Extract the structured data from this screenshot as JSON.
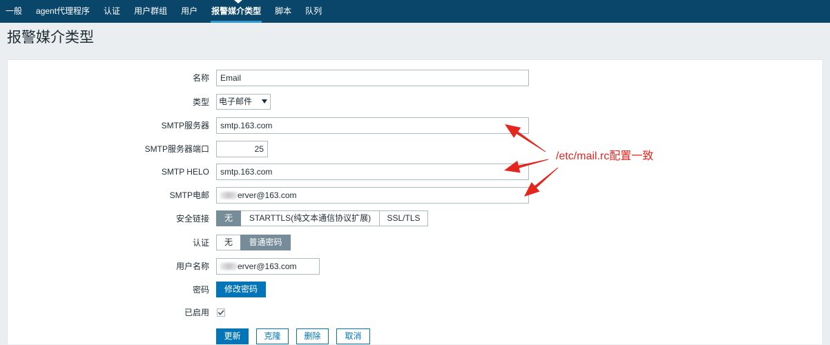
{
  "nav": {
    "items": [
      {
        "label": "一般",
        "active": false
      },
      {
        "label": "agent代理程序",
        "active": false
      },
      {
        "label": "认证",
        "active": false
      },
      {
        "label": "用户群组",
        "active": false
      },
      {
        "label": "用户",
        "active": false
      },
      {
        "label": "报警媒介类型",
        "active": true
      },
      {
        "label": "脚本",
        "active": false
      },
      {
        "label": "队列",
        "active": false
      }
    ]
  },
  "page": {
    "title": "报警媒介类型"
  },
  "form": {
    "name": {
      "label": "名称",
      "value": "Email"
    },
    "type": {
      "label": "类型",
      "value": "电子邮件"
    },
    "smtp_server": {
      "label": "SMTP服务器",
      "value": "smtp.163.com"
    },
    "smtp_port": {
      "label": "SMTP服务器端口",
      "value": "25"
    },
    "smtp_helo": {
      "label": "SMTP HELO",
      "value": "smtp.163.com"
    },
    "smtp_email": {
      "label": "SMTP电邮",
      "value": "erver@163.com"
    },
    "connection_security": {
      "label": "安全链接",
      "options": [
        "无",
        "STARTTLS(纯文本通信协议扩展)",
        "SSL/TLS"
      ],
      "selected_index": 0
    },
    "authentication": {
      "label": "认证",
      "options": [
        "无",
        "普通密码"
      ],
      "selected_index": 1
    },
    "username": {
      "label": "用户名称",
      "value": "erver@163.com"
    },
    "password": {
      "label": "密码",
      "button_label": "修改密码"
    },
    "enabled": {
      "label": "已启用",
      "checked": true
    }
  },
  "actions": {
    "update": "更新",
    "clone": "克隆",
    "delete": "删除",
    "cancel": "取消"
  },
  "annotation": {
    "text": "/etc/mail.rc配置一致"
  },
  "icons": {
    "type_select": "dropdown-arrow-icon",
    "enabled_checkbox": "checkmark-icon",
    "annotation": "red-arrow-icon"
  },
  "colors": {
    "nav_bg": "#0a466a",
    "nav_underline": "#2f95d3",
    "accent": "#0275b8",
    "radio_selected": "#768d99",
    "annotation": "#e5261f"
  }
}
